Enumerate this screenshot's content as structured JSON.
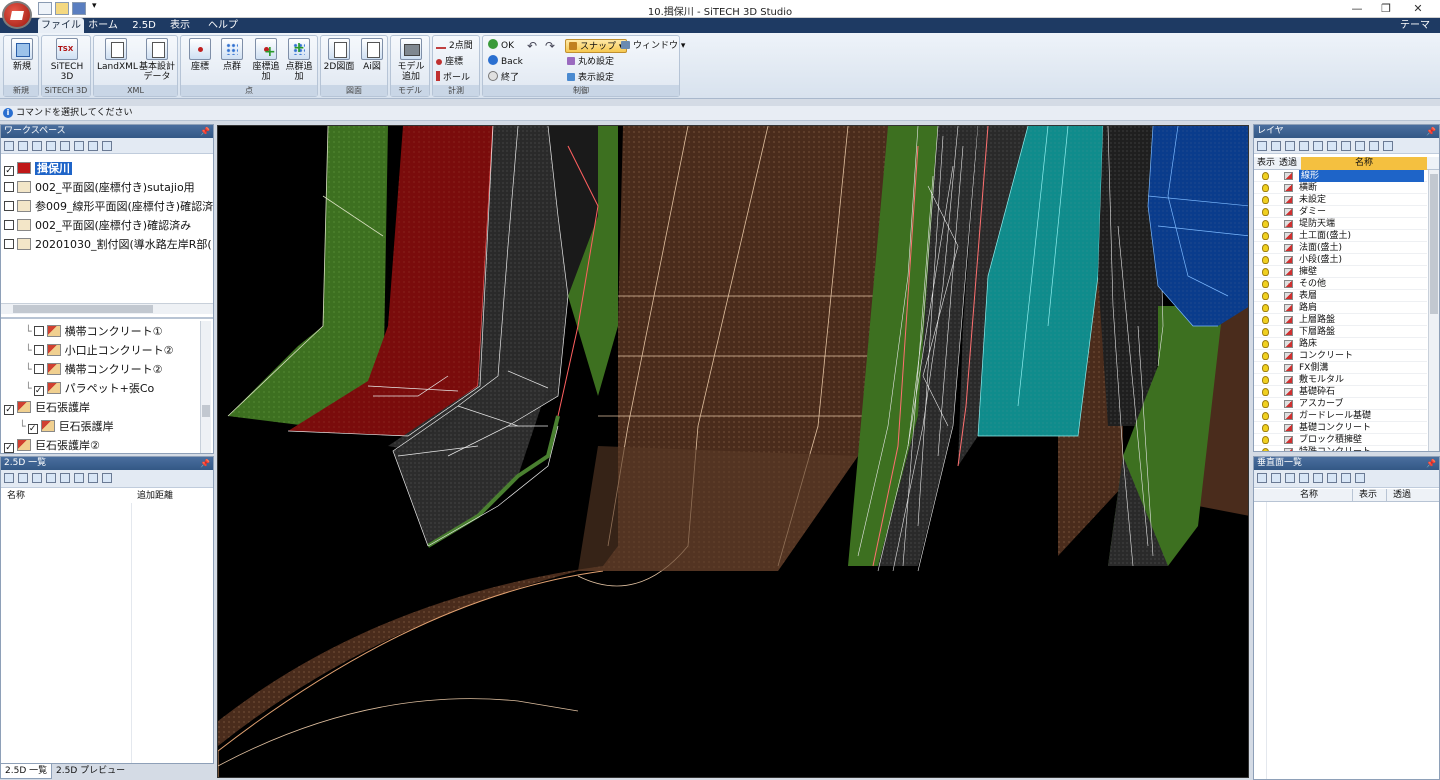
{
  "window": {
    "title": "10.揖保川 - SiTECH 3D Studio",
    "minimize": "—",
    "restore": "❐",
    "close": "✕"
  },
  "menu": {
    "tabs": [
      {
        "label": "ファイル",
        "active": true
      },
      {
        "label": "ホーム",
        "active": false
      },
      {
        "label": "2.5D",
        "active": false
      },
      {
        "label": "表示",
        "active": false
      },
      {
        "label": "ヘルプ",
        "active": false
      }
    ],
    "theme": "テーマ"
  },
  "ribbon": {
    "groups": [
      {
        "label": "新規",
        "buttons": [
          {
            "label": "新規",
            "icon": "new-project-icon"
          }
        ]
      },
      {
        "label": "SiTECH 3D",
        "buttons": [
          {
            "label": "SiTECH 3D",
            "icon": "tsx-file-icon"
          }
        ]
      },
      {
        "label": "XML",
        "buttons": [
          {
            "label": "LandXML",
            "icon": "landxml-icon"
          },
          {
            "label": "基本設計データ",
            "icon": "basic-design-data-icon"
          }
        ]
      },
      {
        "label": "点",
        "buttons": [
          {
            "label": "座標",
            "icon": "coordinate-icon"
          },
          {
            "label": "点群",
            "icon": "point-cloud-icon"
          },
          {
            "label": "座標追加",
            "icon": "add-coordinate-icon"
          },
          {
            "label": "点群追加",
            "icon": "add-point-cloud-icon"
          }
        ]
      },
      {
        "label": "図面",
        "buttons": [
          {
            "label": "2D図面",
            "icon": "2d-drawing-icon"
          },
          {
            "label": "Ai図",
            "icon": "ai-drawing-icon"
          }
        ]
      },
      {
        "label": "モデル",
        "buttons": [
          {
            "label": "モデル追加",
            "icon": "add-model-icon"
          }
        ]
      },
      {
        "label": "計測",
        "buttons": [
          {
            "label": "2点間",
            "icon": "two-point-icon"
          },
          {
            "label": "座標",
            "icon": "measure-coordinate-icon"
          },
          {
            "label": "ポール",
            "icon": "pole-icon"
          }
        ]
      },
      {
        "label": "制御",
        "buttons": [
          {
            "label": "OK",
            "icon": "ok-icon"
          },
          {
            "label": "Back",
            "icon": "back-icon"
          },
          {
            "label": "終了",
            "icon": "end-icon"
          },
          {
            "label": "スナップ",
            "icon": "snap-icon"
          },
          {
            "label": "丸め設定",
            "icon": "rounding-icon"
          },
          {
            "label": "表示設定",
            "icon": "display-settings-icon"
          },
          {
            "label": "ウィンドウ",
            "icon": "window-icon"
          }
        ]
      }
    ]
  },
  "command_bar": {
    "text": "コマンドを選択してください"
  },
  "workspace": {
    "title": "ワークスペース",
    "files": [
      {
        "label": "揖保川",
        "checked": true,
        "selected": true
      },
      {
        "label": "002_平面図(座標付き)sutajio用",
        "checked": false
      },
      {
        "label": "参009_線形平面図(座標付き)確認済",
        "checked": false
      },
      {
        "label": "002_平面図(座標付き)確認済み",
        "checked": false
      },
      {
        "label": "20201030_割付図(導水路左岸R部(",
        "checked": false
      }
    ],
    "layers": [
      {
        "label": "横帯コンクリート①",
        "checked": false,
        "indent": 2
      },
      {
        "label": "小口止コンクリート②",
        "checked": false,
        "indent": 2
      },
      {
        "label": "横帯コンクリート②",
        "checked": false,
        "indent": 2
      },
      {
        "label": "パラペット+張Co",
        "checked": true,
        "indent": 2
      },
      {
        "label": "巨石張護岸",
        "checked": true,
        "indent": 0
      },
      {
        "label": "巨石張護岸",
        "checked": true,
        "indent": 1
      },
      {
        "label": "巨石張護岸②",
        "checked": true,
        "indent": 0
      }
    ]
  },
  "list_25d": {
    "title": "2.5D 一覧",
    "col_name": "名称",
    "col_distance": "追加距離"
  },
  "bottom_tabs": [
    {
      "label": "2.5D 一覧",
      "active": true
    },
    {
      "label": "2.5D プレビュー",
      "active": false
    }
  ],
  "layer_panel": {
    "title": "レイヤ",
    "col_show": "表示",
    "col_trans": "透過",
    "col_name": "名称",
    "rows": [
      "線形",
      "横断",
      "未設定",
      "ダミー",
      "堤防天端",
      "土工面(盛土)",
      "法面(盛土)",
      "小段(盛土)",
      "擁壁",
      "その他",
      "表層",
      "路肩",
      "上層路盤",
      "下層路盤",
      "路床",
      "コンクリート",
      "FX側溝",
      "敷モルタル",
      "基礎砕石",
      "アスカーブ",
      "ガードレール基礎",
      "基礎コンクリート",
      "ブロック積擁壁",
      "特殊コンクリート"
    ],
    "selected_index": 0
  },
  "vertical_panel": {
    "title": "垂直面一覧",
    "col_name": "名称",
    "col_show": "表示",
    "col_trans": "透過"
  },
  "colors": {
    "title_bar": "#1e3a63",
    "panel_header": "#3d6392",
    "selected": "#1e64c8",
    "terrain_brown": "#4a2c1c",
    "red_band": "#7a0c0c",
    "cyan_band": "#0f8c8c",
    "blue_band": "#0a3c8c",
    "green_band": "#3d7020"
  }
}
